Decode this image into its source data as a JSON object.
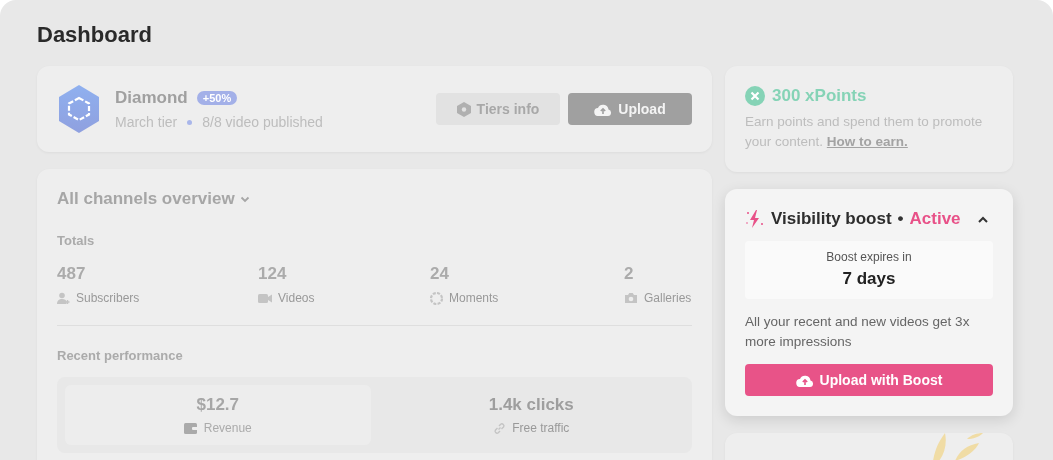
{
  "title": "Dashboard",
  "tier": {
    "name": "Diamond",
    "badge": "+50%",
    "period": "March tier",
    "progress": "8/8 video published",
    "buttons": [
      {
        "label": "Tiers info",
        "kind": "secondary"
      },
      {
        "label": "Upload",
        "kind": "primary"
      }
    ]
  },
  "overview": {
    "heading": "All channels overview",
    "totals_label": "Totals",
    "totals": [
      {
        "value": "487",
        "label": "Subscribers",
        "kind": "user"
      },
      {
        "value": "124",
        "label": "Videos",
        "kind": "video"
      },
      {
        "value": "24",
        "label": "Moments",
        "kind": "moment"
      },
      {
        "value": "2",
        "label": "Galleries",
        "kind": "camera"
      }
    ],
    "recent_label": "Recent performance",
    "performance": [
      {
        "value": "$12.7",
        "label": "Revenue",
        "kind": "wallet",
        "selected": true
      },
      {
        "value": "1.4k clicks",
        "label": "Free traffic",
        "kind": "link",
        "selected": false
      }
    ]
  },
  "points": {
    "title": "300 xPoints",
    "text": "Earn points and spend them to promote your content.",
    "link": "How to earn."
  },
  "boost": {
    "title": "Visibility boost",
    "separator": "•",
    "status": "Active",
    "expanded": true,
    "expires_label": "Boost expires in",
    "expires_value": "7 days",
    "text": "All your recent and new videos get 3x more impressions",
    "button": "Upload with Boost"
  }
}
